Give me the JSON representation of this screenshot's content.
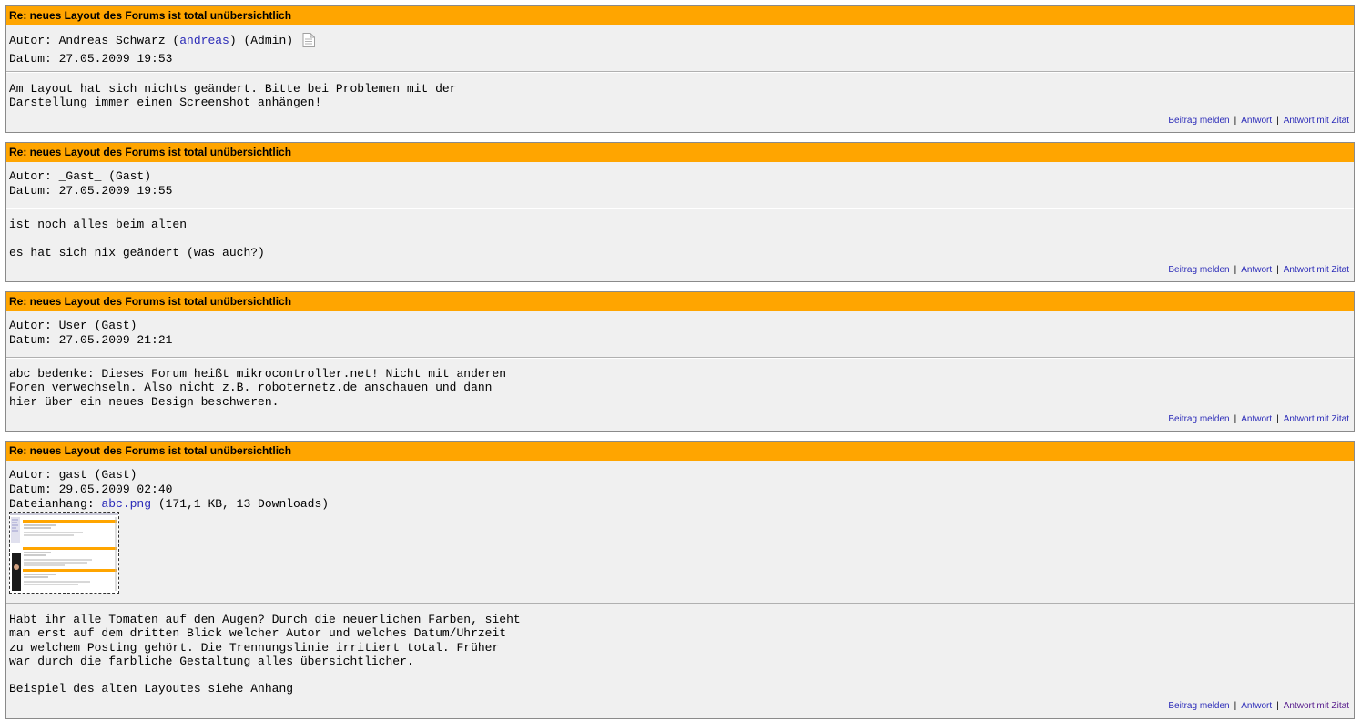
{
  "posts": [
    {
      "title": "Re: neues Layout des Forums ist total unübersichtlich",
      "author_prefix": "Autor: Andreas Schwarz (",
      "author_link": "andreas",
      "author_suffix": ") (Admin)",
      "date_line": "Datum: 27.05.2009 19:53",
      "body": "Am Layout hat sich nichts geändert. Bitte bei Problemen mit der\nDarstellung immer einen Screenshot anhängen!",
      "actions": {
        "report": "Beitrag melden",
        "reply": "Antwort",
        "quote": "Antwort mit Zitat",
        "separator": "|"
      }
    },
    {
      "title": "Re: neues Layout des Forums ist total unübersichtlich",
      "author_line": "Autor: _Gast_ (Gast)",
      "date_line": "Datum: 27.05.2009 19:55",
      "body": "ist noch alles beim alten\n\nes hat sich nix geändert (was auch?)",
      "actions": {
        "report": "Beitrag melden",
        "reply": "Antwort",
        "quote": "Antwort mit Zitat",
        "separator": "|"
      }
    },
    {
      "title": "Re: neues Layout des Forums ist total unübersichtlich",
      "author_line": "Autor: User (Gast)",
      "date_line": "Datum: 27.05.2009 21:21",
      "body": "abc bedenke: Dieses Forum heißt mikrocontroller.net! Nicht mit anderen\nForen verwechseln. Also nicht z.B. roboternetz.de anschauen und dann\nhier über ein neues Design beschweren.",
      "actions": {
        "report": "Beitrag melden",
        "reply": "Antwort",
        "quote": "Antwort mit Zitat",
        "separator": "|"
      }
    },
    {
      "title": "Re: neues Layout des Forums ist total unübersichtlich",
      "author_line": "Autor: gast (Gast)",
      "date_line": "Datum: 29.05.2009 02:40",
      "attachment_label": "Dateianhang: ",
      "attachment_name": "abc.png",
      "attachment_info": " (171,1 KB, 13 Downloads)",
      "body": "Habt ihr alle Tomaten auf den Augen? Durch die neuerlichen Farben, sieht\nman erst auf dem dritten Blick welcher Autor und welches Datum/Uhrzeit\nzu welchem Posting gehört. Die Trennungslinie irritiert total. Früher\nwar durch die farbliche Gestaltung alles übersichtlicher.\n\nBeispiel des alten Layoutes siehe Anhang",
      "actions": {
        "report": "Beitrag melden",
        "reply": "Antwort",
        "quote": "Antwort mit Zitat",
        "separator": "|"
      }
    }
  ],
  "colors": {
    "title_bar": "#ffa500",
    "post_background": "#f0f0f0",
    "link": "#2b2bb8",
    "visited_link": "#551a8b"
  },
  "icons": {
    "author_page": "document-icon"
  }
}
